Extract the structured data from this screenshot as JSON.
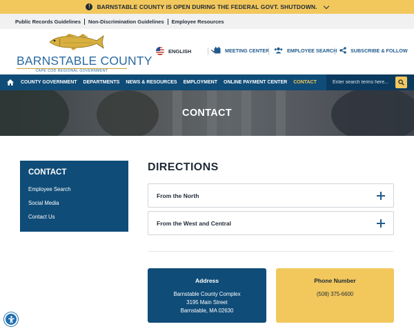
{
  "alert": {
    "text": "BARNSTABLE COUNTY IS OPEN DURING THE FEDERAL GOVT. SHUTDOWN.",
    "icon": "info-icon",
    "color": "#f2c75c"
  },
  "utility": {
    "links": [
      "Public Records Guidelines",
      "Non-Discrimination Guidelines",
      "Employee Resources"
    ]
  },
  "logo": {
    "title": "BARNSTABLE COUNTY",
    "subtitle": "CAPE COD REGIONAL GOVERNMENT"
  },
  "header": {
    "language": "ENGLISH",
    "tools": [
      {
        "label": "MEETING CENTER",
        "icon": "calendar-icon"
      },
      {
        "label": "EMPLOYEE SEARCH",
        "icon": "users-icon"
      },
      {
        "label": "SUBSCRIBE & FOLLOW",
        "icon": "share-icon"
      }
    ]
  },
  "nav": {
    "items": [
      "COUNTY GOVERNMENT",
      "DEPARTMENTS",
      "NEWS & RESOURCES",
      "EMPLOYMENT",
      "ONLINE PAYMENT CENTER",
      "CONTACT"
    ],
    "active": "CONTACT",
    "search_placeholder": "Enter search terms here...",
    "color": "#0f4c78"
  },
  "hero": {
    "title": "CONTACT"
  },
  "sidebar": {
    "title": "CONTACT",
    "items": [
      "Employee Search",
      "Social Media",
      "Contact Us"
    ]
  },
  "main": {
    "heading": "DIRECTIONS",
    "accordions": [
      "From the North",
      "From the West and Central"
    ]
  },
  "cards": {
    "address": {
      "heading": "Address",
      "lines": [
        "Barnstable County Complex",
        "3195 Main Street",
        "Barnstable, MA 02630"
      ]
    },
    "phone": {
      "heading": "Phone Number",
      "lines": [
        "(508) 375-6600"
      ]
    }
  }
}
